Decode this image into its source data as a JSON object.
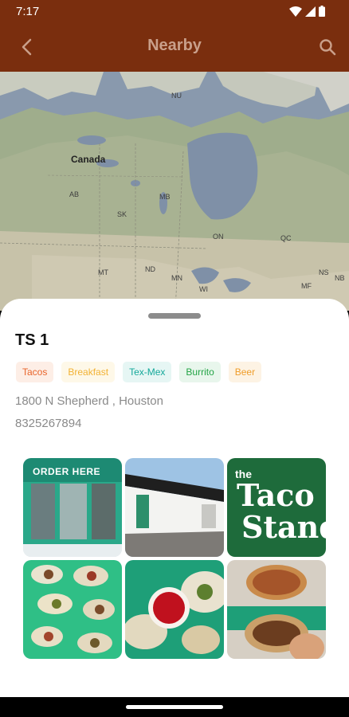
{
  "status_bar": {
    "time": "7:17"
  },
  "app_bar": {
    "title": "Nearby"
  },
  "map": {
    "labels": {
      "canada": "Canada",
      "nu": "NU",
      "ab": "AB",
      "sk": "SK",
      "mb": "MB",
      "on": "ON",
      "qc": "QC",
      "mt": "MT",
      "nd": "ND",
      "mn": "MN",
      "wi": "WI",
      "ns": "NS",
      "nb": "NB",
      "mf": "MF"
    }
  },
  "place": {
    "name": "TS 1",
    "tags": [
      {
        "label": "Tacos",
        "color": "#e8642a",
        "bg": "#fdeee6"
      },
      {
        "label": "Breakfast",
        "color": "#f2b234",
        "bg": "#fef8e8"
      },
      {
        "label": "Tex-Mex",
        "color": "#14a89a",
        "bg": "#e6f6f4"
      },
      {
        "label": "Burrito",
        "color": "#23a445",
        "bg": "#e8f6ec"
      },
      {
        "label": "Beer",
        "color": "#ef9d2a",
        "bg": "#fdf3e4"
      }
    ],
    "address": "1800 N Shepherd , Houston",
    "phone": "8325267894"
  },
  "gallery": {
    "photo1_sign": "ORDER HERE",
    "photo3_logo_small": "the",
    "photo3_logo_line1": "Taco",
    "photo3_logo_line2": "Stand"
  }
}
